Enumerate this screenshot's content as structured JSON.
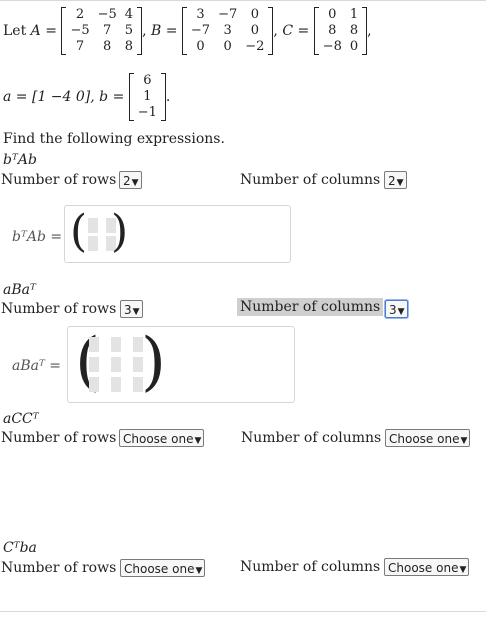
{
  "defs": {
    "let_label": "Let",
    "A_name": "A",
    "B_name": "B",
    "C_name": "C",
    "eq": "=",
    "comma": ",",
    "A": [
      [
        "2",
        "−5",
        "4"
      ],
      [
        "−5",
        "7",
        "5"
      ],
      [
        "7",
        "8",
        "8"
      ]
    ],
    "B": [
      [
        "3",
        "−7",
        "0"
      ],
      [
        "−7",
        "3",
        "0"
      ],
      [
        "0",
        "0",
        "−2"
      ]
    ],
    "C": [
      [
        "0",
        "1"
      ],
      [
        "8",
        "8"
      ],
      [
        "−8",
        "0"
      ]
    ],
    "a_text": "a = [1   −4   0], b =",
    "b": [
      [
        "6"
      ],
      [
        "1"
      ],
      [
        "−1"
      ]
    ],
    "period": "."
  },
  "instructions": "Find the following expressions.",
  "problems": [
    {
      "title": "bᵀAb",
      "rows_label": "Number of rows",
      "rows_value": "2",
      "cols_label": "Number of columns",
      "cols_value": "2",
      "answer_label": "bᵀAb ="
    },
    {
      "title": "aBaᵀ",
      "rows_label": "Number of rows",
      "rows_value": "3",
      "cols_label": "Number of columns",
      "cols_value": "3",
      "answer_label": "aBaᵀ ="
    },
    {
      "title": "aCCᵀ",
      "rows_label": "Number of rows",
      "rows_value": "Choose one",
      "cols_label": "Number of columns",
      "cols_value": "Choose one"
    },
    {
      "title": "Cᵀba",
      "rows_label": "Number of rows",
      "rows_value": "Choose one",
      "cols_label": "Number of columns",
      "cols_value": "Choose one"
    }
  ],
  "icons": {
    "dropdown": "triangle-down-icon"
  }
}
